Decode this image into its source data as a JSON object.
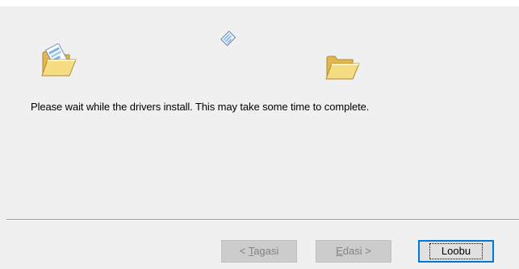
{
  "message": "Please wait while the drivers install. This may take some time to complete.",
  "buttons": {
    "back": {
      "prefix": "< ",
      "mnemonic": "T",
      "rest": "agasi"
    },
    "next": {
      "mnemonic": "E",
      "rest": "dasi",
      "suffix": " >"
    },
    "cancel": "Loobu"
  },
  "icons": {
    "source": "open-folder-with-document-icon",
    "animation": "flying-document-icon",
    "destination": "open-folder-icon"
  },
  "colors": {
    "folder": "#f3d77a",
    "focus_border": "#0078d7",
    "disabled_text": "#838383"
  }
}
